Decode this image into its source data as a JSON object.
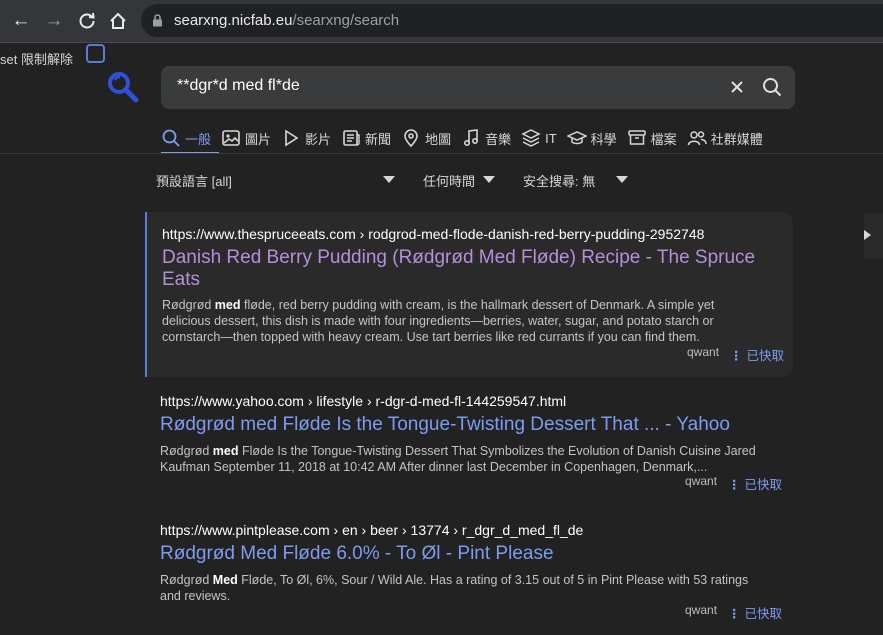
{
  "browser": {
    "url_host": "searxng.nicfab.eu",
    "url_path": "/searxng/search"
  },
  "reset": {
    "label": "set 限制解除"
  },
  "search": {
    "query": "**dgr*d med fl*de"
  },
  "categories": [
    {
      "label": "一般",
      "icon": "search-icon",
      "active": true
    },
    {
      "label": "圖片",
      "icon": "image-icon"
    },
    {
      "label": "影片",
      "icon": "play-icon"
    },
    {
      "label": "新聞",
      "icon": "newspaper-icon"
    },
    {
      "label": "地圖",
      "icon": "map-pin-icon"
    },
    {
      "label": "音樂",
      "icon": "music-icon"
    },
    {
      "label": "IT",
      "icon": "layers-icon"
    },
    {
      "label": "科學",
      "icon": "graduation-icon"
    },
    {
      "label": "檔案",
      "icon": "archive-icon"
    },
    {
      "label": "社群媒體",
      "icon": "people-icon"
    }
  ],
  "filters": {
    "language": "預設語言 [all]",
    "time": "任何時間",
    "safesearch": "安全搜尋: 無"
  },
  "results": [
    {
      "url": "https://www.thespruceeats.com  › rodgrod-med-flode-danish-red-berry-pudding-2952748",
      "title": "Danish Red Berry Pudding (Rødgrød Med Fløde) Recipe - The Spruce Eats",
      "snippet_pre": "Rødgrød ",
      "snippet_bold": "med",
      "snippet_post": " fløde, red berry pudding with cream, is the hallmark dessert of Denmark. A simple yet delicious dessert, this dish is made with four ingredients—berries, water, sugar, and potato starch or cornstarch—then topped with heavy cream. Use tart berries like red currants if you can find them.",
      "engine": "qwant",
      "cache": "已快取"
    },
    {
      "url": "https://www.yahoo.com  › lifestyle › r-dgr-d-med-fl-144259547.html",
      "title": "Rødgrød med Fløde Is the Tongue-Twisting Dessert That ... - Yahoo",
      "snippet_pre": "Rødgrød ",
      "snippet_bold": "med",
      "snippet_post": " Fløde Is the Tongue-Twisting Dessert That Symbolizes the Evolution of Danish Cuisine Jared Kaufman September 11, 2018 at 10:42 AM After dinner last December in Copenhagen, Denmark,...",
      "engine": "qwant",
      "cache": "已快取"
    },
    {
      "url": "https://www.pintplease.com  › en › beer › 13774 › r_dgr_d_med_fl_de",
      "title": "Rødgrød Med Fløde 6.0% - To Øl - Pint Please",
      "snippet_pre": "Rødgrød ",
      "snippet_bold": "Med",
      "snippet_post": " Fløde, To Øl, 6%, Sour / Wild Ale. Has a rating of 3.15 out of 5 in Pint Please with 53 ratings and reviews.",
      "engine": "qwant",
      "cache": "已快取"
    }
  ],
  "colors": {
    "background": "#222222",
    "link": "#7d9cf0",
    "visited": "#b490d8",
    "accent": "#5a7cd8"
  }
}
